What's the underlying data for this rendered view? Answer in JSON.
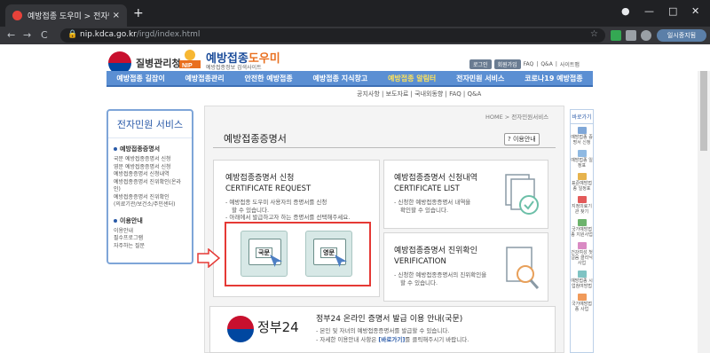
{
  "browser": {
    "tab_title": "예방접종 도우미 > 전자민원서",
    "tab_close": "×",
    "new_tab": "+",
    "url_host": "nip.kdca.go.kr",
    "url_path": "/irgd/index.html",
    "profile_label": "일시중지됨",
    "back": "←",
    "forward": "→",
    "reload": "C",
    "home": "⌂",
    "min": "—",
    "max": "□",
    "close": "✕"
  },
  "header": {
    "gov_name": "질병관리청",
    "site_name_a": "예방접종",
    "site_name_b": "도우미",
    "site_sub": "예방접종정보 검색사이트",
    "top_links": [
      "로그인",
      "회원가입",
      "FAQ",
      "Q&A",
      "사이트맵"
    ]
  },
  "mainnav": [
    {
      "label": "예방접종 길잡이",
      "active": false
    },
    {
      "label": "예방접종관리",
      "active": false
    },
    {
      "label": "안전한 예방접종",
      "active": false
    },
    {
      "label": "예방접종 지식창고",
      "active": false
    },
    {
      "label": "예방접종 알림터",
      "active": true
    },
    {
      "label": "전자민원 서비스",
      "active": false
    },
    {
      "label": "코로나19 예방접종",
      "active": false
    }
  ],
  "subnav": "공지사항 | 보도자료 | 국내외동향 | FAQ | Q&A",
  "sidebar": {
    "title": "전자민원 서비스",
    "sec1_title": "예방접종증명서",
    "sec1_items": [
      "국문 예방접종증명서 신청",
      "영문 예방접종증명서 신청",
      "예방접종증명서 신청내역",
      "예방접종증명서 진위확인(온라인)",
      "예방접종증명서 진위확인",
      "(의료기관/보건소/주민센터)"
    ],
    "sec2_title": "이용안내",
    "sec2_items": [
      "이용안내",
      "필수프로그램",
      "자주하는 질문"
    ]
  },
  "content": {
    "breadcrumb": "HOME > 전자민원서비스",
    "title": "예방접종증명서",
    "help_label": "? 이용안내",
    "card1": {
      "title": "예방접종증명서 신청",
      "sub": "CERTIFICATE REQUEST",
      "desc1": "- 예방접종 도우미 사용자의 증명서를 신청",
      "desc1b": "할 수 있습니다.",
      "desc2": "- 아래에서 발급하고자 하는 증명서를 선택해주세요.",
      "btn_kor": "국문",
      "btn_eng": "영문"
    },
    "card2": {
      "title": "예방접종증명서 신청내역",
      "sub": "CERTIFICATE LIST",
      "desc1": "- 신청한 예방접종증명서 내역을",
      "desc2": "확인할 수 있습니다."
    },
    "card3": {
      "title": "예방접종증명서 진위확인",
      "sub": "VERIFICATION",
      "desc1": "- 신청한 예방접종증명서의 진위확인을",
      "desc2": "할 수 있습니다."
    },
    "gov24": {
      "logo_text": "정부24",
      "title": "정부24 온라인 증명서 발급 이용 안내(국문)",
      "desc1": "- 본인 및 자녀의 예방접종증명서를 발급할 수 있습니다.",
      "desc2a": "- 자세한 이용안내 사항은 ",
      "desc2link": "[바로가기]",
      "desc2b": "를 클릭해주시기 바랍니다."
    }
  },
  "right_bar": {
    "title": "바로가기",
    "items": [
      "예방접종 증명서 신청",
      "예방접종 일정표",
      "표준예방접종 일정표",
      "지정의료기관 찾기",
      "국가예방접종 지원사업",
      "건강여성 첫걸음 클리닉사업",
      "예방접종 시업참여방법",
      "국가예방접종 사업"
    ]
  },
  "colors": {
    "nav_blue": "#5b8fd3",
    "highlight_red": "#e53935",
    "active_nav": "#ffe35a"
  }
}
